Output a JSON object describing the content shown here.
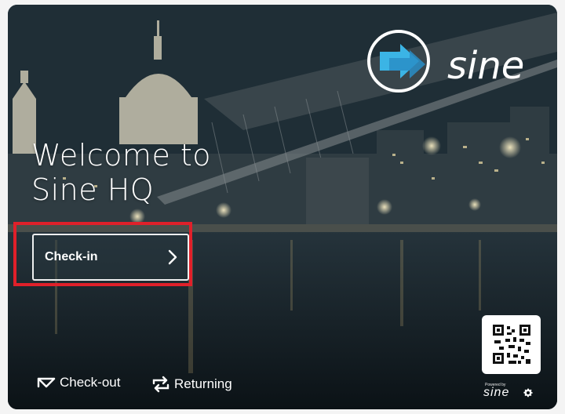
{
  "brand": {
    "name": "sine",
    "accent_color": "#3bb4e5"
  },
  "welcome": {
    "line1": "Welcome to",
    "line2": "Sine HQ"
  },
  "actions": {
    "checkin_label": "Check-in",
    "checkout_label": "Check-out",
    "returning_label": "Returning"
  },
  "footer": {
    "powered_by": "Powered by",
    "powered_brand": "sine"
  },
  "icons": {
    "checkin_chevron": "chevron-right-icon",
    "checkout": "arrow-up-left-icon",
    "returning": "repeat-icon",
    "qr": "qr-code-icon",
    "settings": "gear-icon"
  }
}
